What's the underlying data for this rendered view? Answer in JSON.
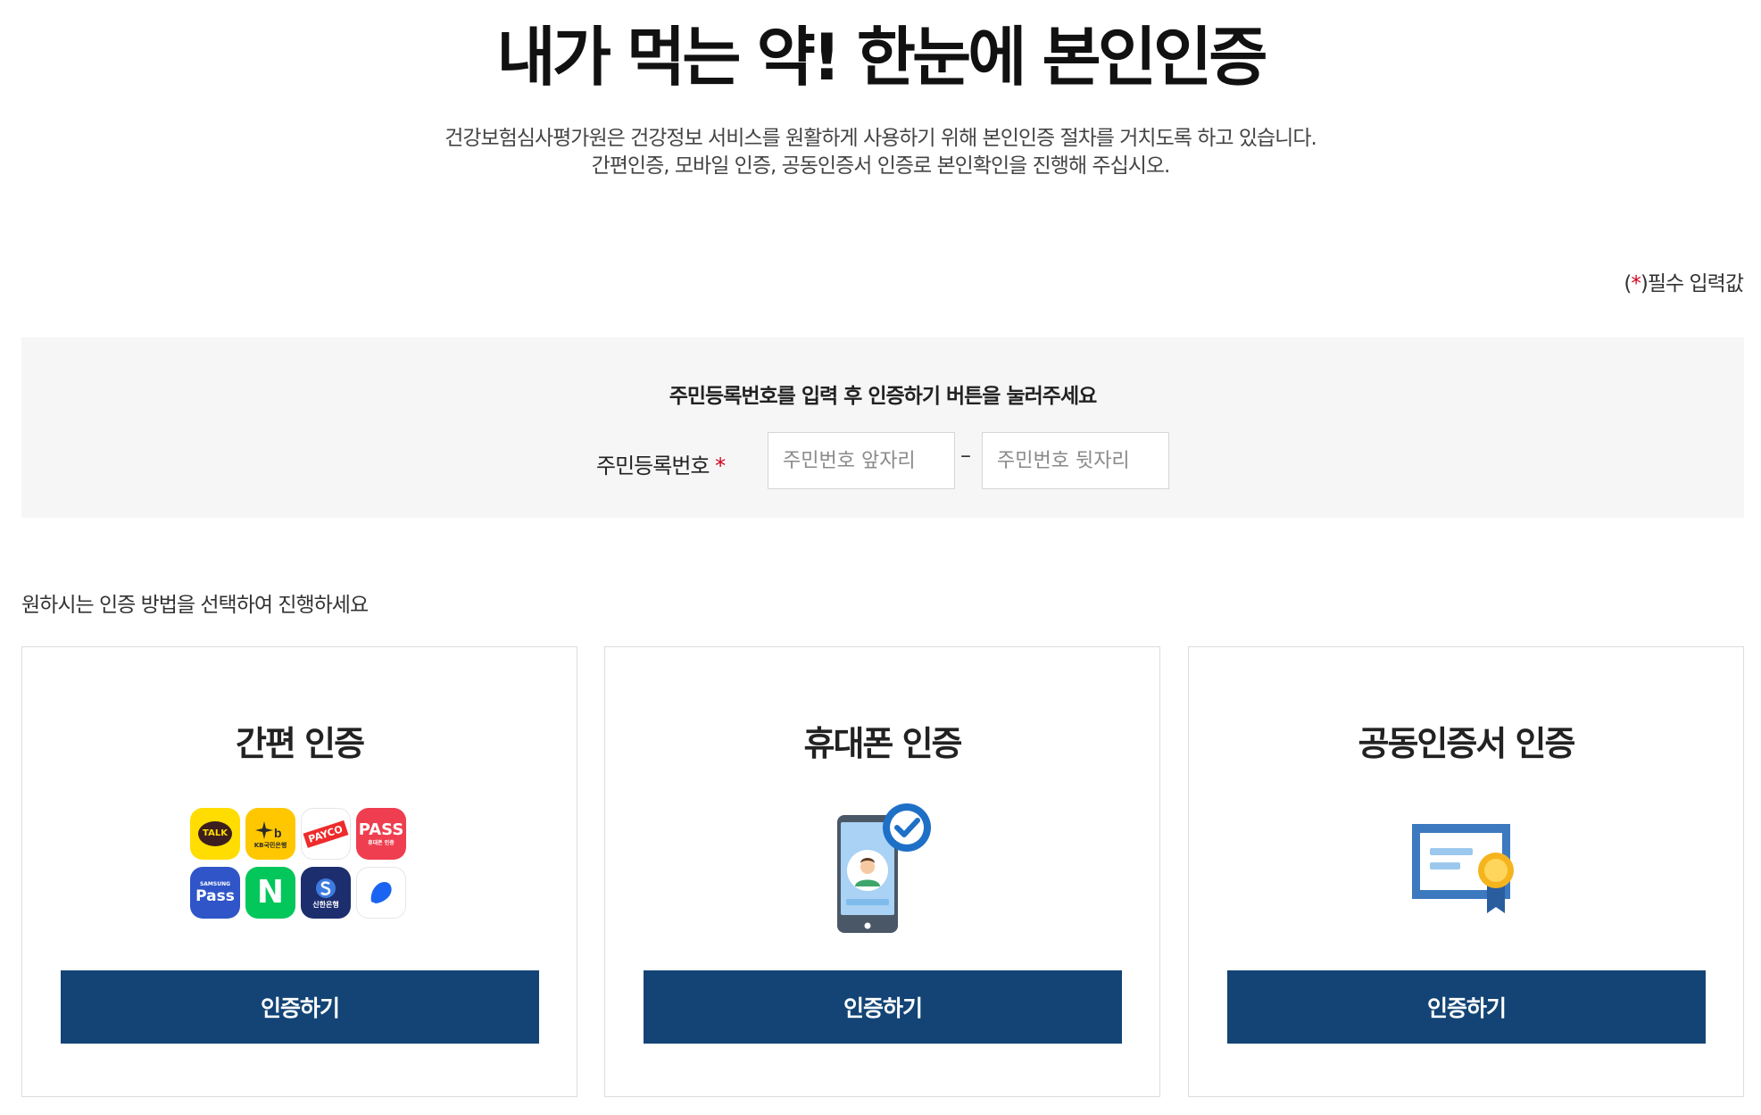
{
  "header": {
    "title": "내가 먹는 약! 한눈에 본인인증",
    "desc_line1": "건강보험심사평가원은 건강정보 서비스를 원활하게 사용하기 위해 본인인증 절차를 거치도록 하고 있습니다.",
    "desc_line2": "간편인증, 모바일 인증, 공동인증서 인증로 본인확인을 진행해 주십시오."
  },
  "required_note": {
    "prefix": "(",
    "star": "*",
    "suffix": ")필수 입력값"
  },
  "id_form": {
    "guide": "주민등록번호를 입력 후 인증하기 버튼을 눌러주세요",
    "label": "주민등록번호",
    "star": "*",
    "front_placeholder": "주민번호 앞자리",
    "dash": "–",
    "back_placeholder": "주민번호 뒷자리"
  },
  "method_guide": "원하시는 인증 방법을 선택하여 진행하세요",
  "cards": [
    {
      "title": "간편 인증",
      "button": "인증하기",
      "apps": [
        {
          "icon": "kakaotalk-icon",
          "label": "TALK",
          "bg": "#ffdd00"
        },
        {
          "icon": "kb-bank-icon",
          "label": "KB국민은행",
          "bg": "#ffc700"
        },
        {
          "icon": "payco-icon",
          "label": "PAYCO",
          "bg": "#ffffff"
        },
        {
          "icon": "pass-icon",
          "label": "PASS",
          "sublabel": "휴대폰 인증",
          "bg": "#ee3e4f"
        },
        {
          "icon": "samsung-pass-icon",
          "label": "Pass",
          "sublabel": "SAMSUNG",
          "bg": "#2f55c8"
        },
        {
          "icon": "naver-icon",
          "label": "N",
          "bg": "#03c75a"
        },
        {
          "icon": "shinhan-bank-icon",
          "label": "신한은행",
          "bg": "#1c2e6e"
        },
        {
          "icon": "toss-icon",
          "label": "",
          "bg": "#ffffff"
        }
      ]
    },
    {
      "title": "휴대폰 인증",
      "button": "인증하기",
      "illustration": "phone-verify-icon"
    },
    {
      "title": "공동인증서 인증",
      "button": "인증하기",
      "illustration": "certificate-icon"
    }
  ],
  "colors": {
    "primary_button": "#134475",
    "required_star": "#d0021b",
    "form_background": "#f6f6f6"
  }
}
